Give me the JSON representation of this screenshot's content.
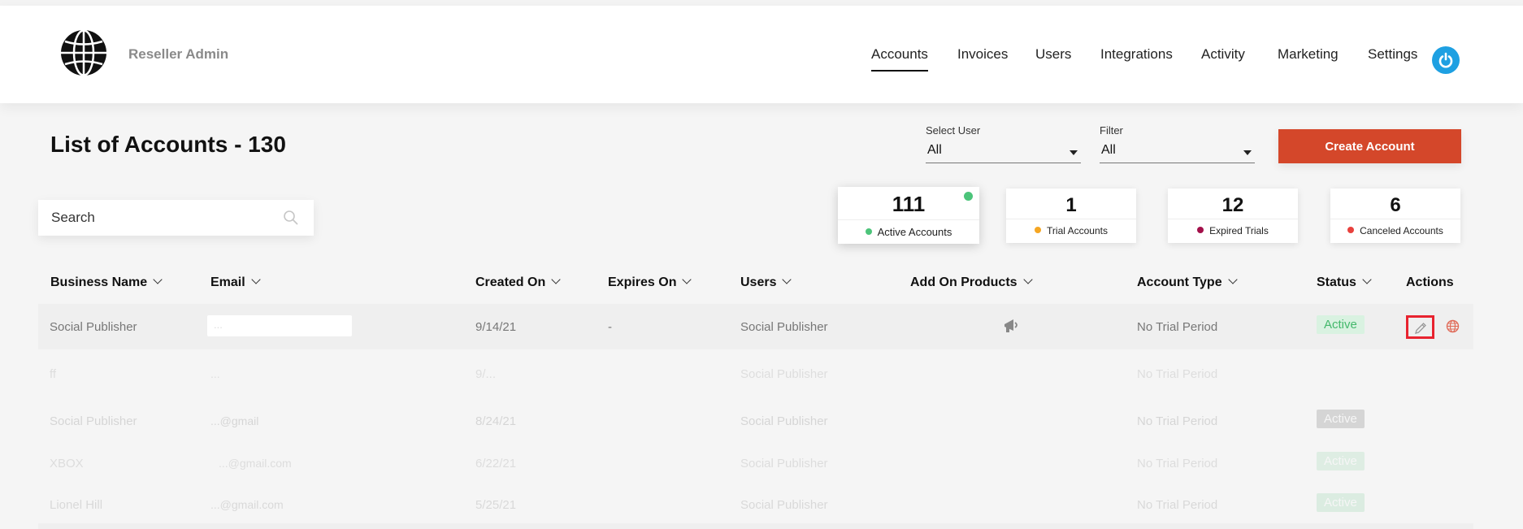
{
  "header": {
    "brand": "Reseller Admin",
    "nav": [
      {
        "label": "Accounts",
        "active": true
      },
      {
        "label": "Invoices",
        "active": false
      },
      {
        "label": "Users",
        "active": false
      },
      {
        "label": "Integrations",
        "active": false
      },
      {
        "label": "Activity",
        "active": false
      },
      {
        "label": "Marketing",
        "active": false
      },
      {
        "label": "Settings",
        "active": false
      }
    ],
    "power_icon": "power-icon",
    "accent_color": "#1ea0e2"
  },
  "page": {
    "title": "List of Accounts - 130"
  },
  "filters": {
    "select_user": {
      "label": "Select User",
      "value": "All"
    },
    "filter": {
      "label": "Filter",
      "value": "All"
    }
  },
  "create_button": {
    "label": "Create Account",
    "color": "#d4472a"
  },
  "search": {
    "placeholder": "Search"
  },
  "stats": [
    {
      "value": "111",
      "label": "Active Accounts",
      "dot_color": "#4cc47a"
    },
    {
      "value": "1",
      "label": "Trial Accounts",
      "dot_color": "#f5a623"
    },
    {
      "value": "12",
      "label": "Expired Trials",
      "dot_color": "#a3104a"
    },
    {
      "value": "6",
      "label": "Canceled Accounts",
      "dot_color": "#e8413d"
    }
  ],
  "table": {
    "columns": [
      "Business Name",
      "Email",
      "Created On",
      "Expires On",
      "Users",
      "Add On Products",
      "Account Type",
      "Status",
      "Actions"
    ],
    "rows": [
      {
        "business": "Social Publisher",
        "email": "...",
        "created": "9/14/21",
        "expires": "-",
        "users": "Social Publisher",
        "type": "No Trial Period",
        "status": "Active"
      },
      {
        "business": "ff",
        "email": "...",
        "created": "9/...",
        "expires": "",
        "users": "Social Publisher",
        "type": "No Trial Period",
        "status": ""
      },
      {
        "business": "Social Publisher",
        "email": "...@gmail",
        "created": "8/24/21",
        "expires": "",
        "users": "Social Publisher",
        "type": "No Trial Period",
        "status": "Active"
      },
      {
        "business": "XBOX",
        "email": "...@gmail.com",
        "created": "6/22/21",
        "expires": "",
        "users": "Social Publisher",
        "type": "No Trial Period",
        "status": "Active"
      },
      {
        "business": "Lionel Hill",
        "email": "...@gmail.com",
        "created": "5/25/21",
        "expires": "",
        "users": "Social Publisher",
        "type": "No Trial Period",
        "status": "Active"
      }
    ]
  },
  "status_colors": {
    "active_bg": "#d9f2e1",
    "active_text": "#43b86b",
    "edit_highlight": "#e8232f"
  }
}
